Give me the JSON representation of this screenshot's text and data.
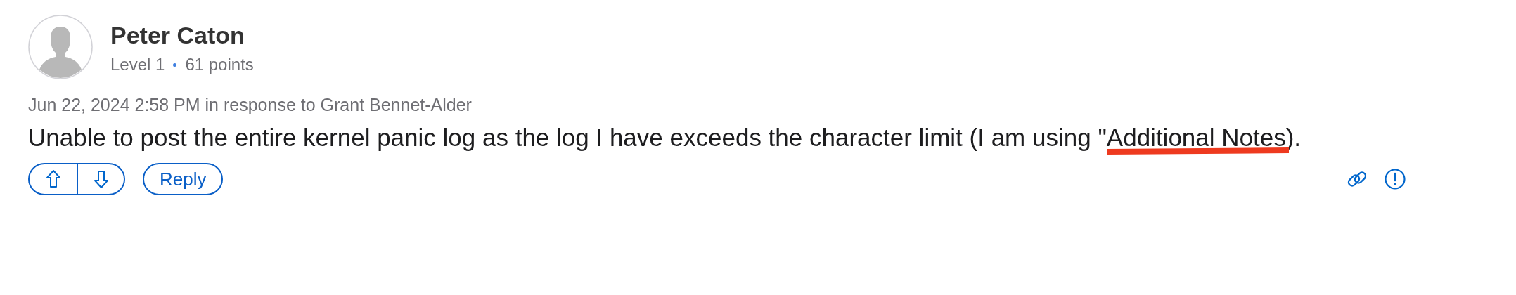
{
  "author": {
    "name": "Peter Caton",
    "level": "Level 1",
    "points": "61 points"
  },
  "post": {
    "meta": "Jun 22, 2024 2:58 PM in response to Grant Bennet-Alder",
    "body": [
      {
        "text": "Unable to post the entire kernel panic log as the log I have exceeds the character limit (I am using \"",
        "highlighted": false
      },
      {
        "text": "Additional Notes",
        "highlighted": true
      },
      {
        "text": ").",
        "highlighted": false
      }
    ]
  },
  "actions": {
    "reply": "Reply"
  }
}
